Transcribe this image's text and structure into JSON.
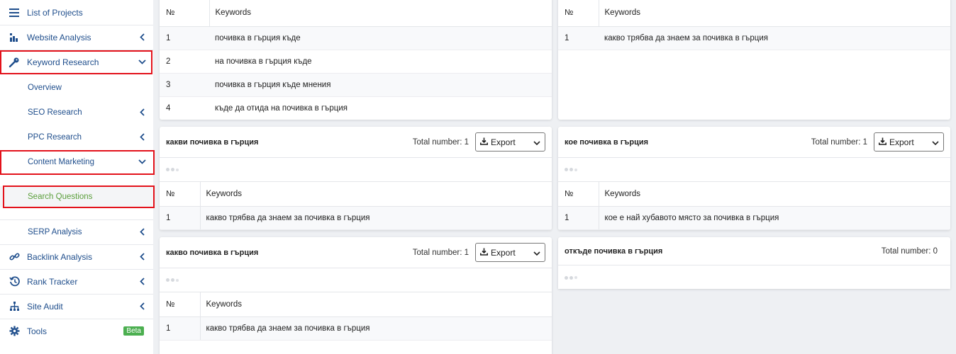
{
  "sidebar": {
    "list_of_projects": "List of Projects",
    "website_analysis": "Website Analysis",
    "keyword_research": "Keyword Research",
    "overview": "Overview",
    "seo_research": "SEO Research",
    "ppc_research": "PPC Research",
    "content_marketing": "Content Marketing",
    "search_questions": "Search Questions",
    "serp_analysis": "SERP Analysis",
    "backlink_analysis": "Backlink Analysis",
    "rank_tracker": "Rank Tracker",
    "site_audit": "Site Audit",
    "tools": "Tools",
    "beta": "Beta"
  },
  "colors": {
    "nav_text": "#1f4e8c",
    "active_item": "#5a9e3a",
    "highlight": "#e3121b",
    "beta": "#4caf50"
  },
  "common": {
    "no_header": "№",
    "keywords_header": "Keywords",
    "export": "Export"
  },
  "cards": {
    "top_left": {
      "rows": [
        {
          "n": "1",
          "kw": "почивка в гърция къде"
        },
        {
          "n": "2",
          "kw": "на почивка в гърция къде"
        },
        {
          "n": "3",
          "kw": "почивка в гърция къде мнения"
        },
        {
          "n": "4",
          "kw": "къде да отида на почивка в гърция"
        }
      ]
    },
    "top_right": {
      "rows": [
        {
          "n": "1",
          "kw": "какво трябва да знаем за почивка в гърция"
        }
      ]
    },
    "kakvi": {
      "title": "какви почивка в гърция",
      "total": "Total number: 1",
      "rows": [
        {
          "n": "1",
          "kw": "какво трябва да знаем за почивка в гърция"
        }
      ]
    },
    "koe": {
      "title": "кое почивка в гърция",
      "total": "Total number: 1",
      "rows": [
        {
          "n": "1",
          "kw": "кое е най хубавото място за почивка в гърция"
        }
      ]
    },
    "kakvo": {
      "title": "какво почивка в гърция",
      "total": "Total number: 1",
      "rows": [
        {
          "n": "1",
          "kw": "какво трябва да знаем за почивка в гърция"
        }
      ]
    },
    "otkade": {
      "title": "откъде почивка в гърция",
      "total": "Total number: 0"
    }
  }
}
